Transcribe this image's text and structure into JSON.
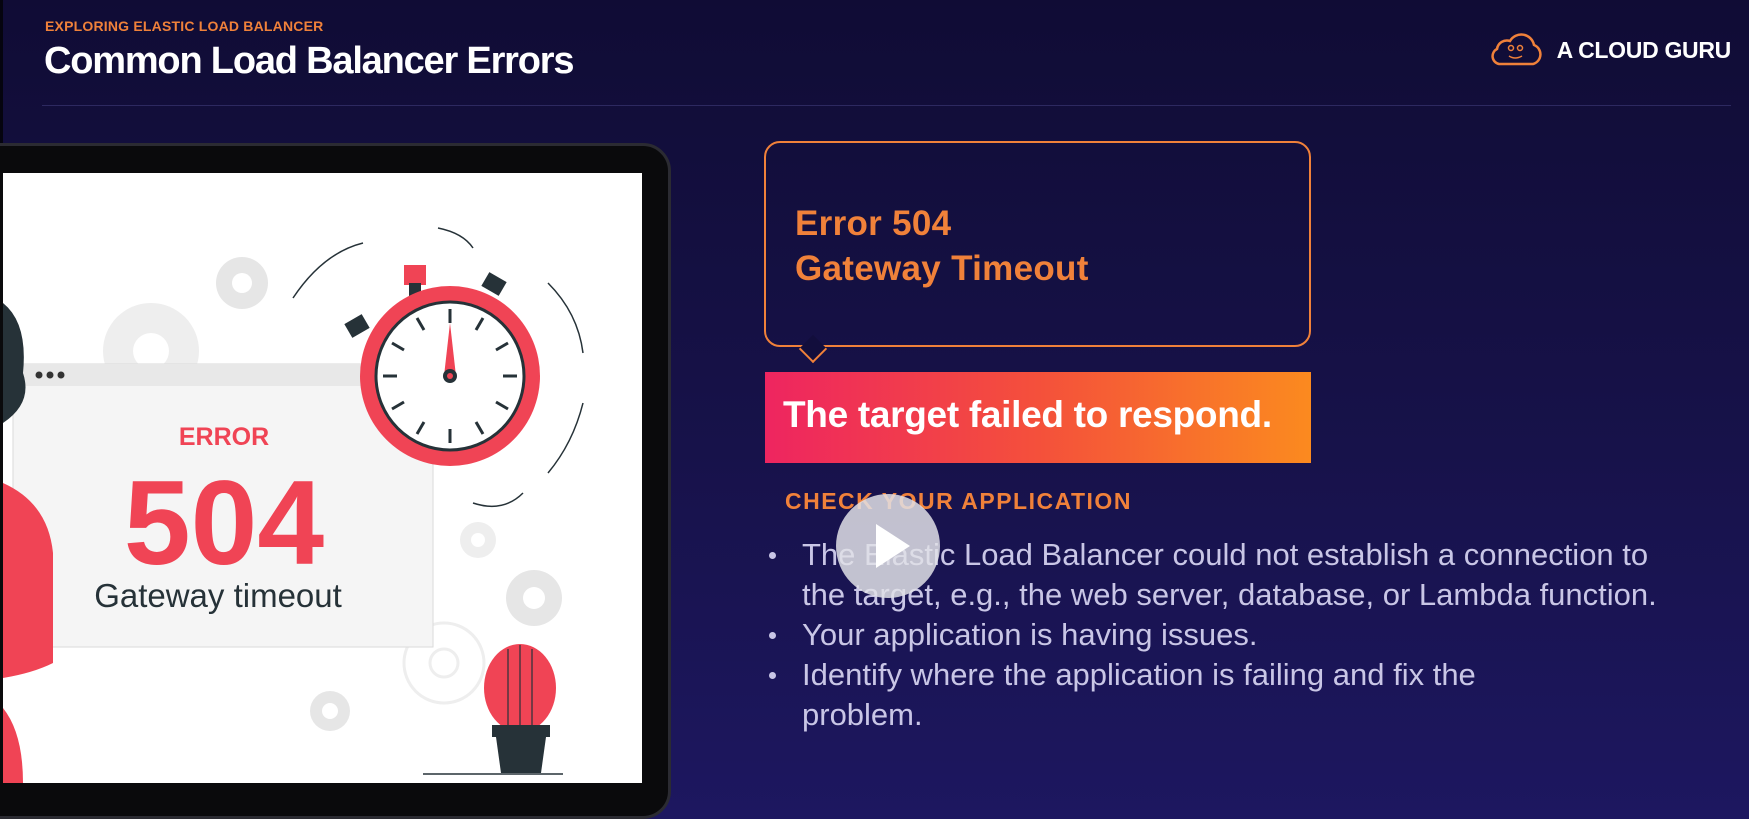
{
  "header": {
    "kicker": "EXPLORING ELASTIC LOAD BALANCER",
    "title": "Common Load Balancer Errors",
    "brand": "A CLOUD GURU"
  },
  "illustration": {
    "error_label": "ERROR",
    "error_code": "504",
    "error_text": "Gateway timeout"
  },
  "bubble": {
    "line1": "Error 504",
    "line2": "Gateway Timeout"
  },
  "banner": {
    "text": "The target failed to respond."
  },
  "section": {
    "heading": "CHECK YOUR APPLICATION",
    "bullets": [
      "The Elastic Load Balancer could not establish a connection to the target, e.g., the web server, database, or Lambda function.",
      "Your application is having issues.",
      "Identify where the application is failing and fix the problem."
    ]
  },
  "icons": {
    "brand_logo": "cloud-icon",
    "play": "play-icon"
  },
  "colors": {
    "accent": "#f0813a",
    "banner_start": "#ee2560",
    "banner_end": "#fb8a1f",
    "error_red": "#f04455"
  }
}
